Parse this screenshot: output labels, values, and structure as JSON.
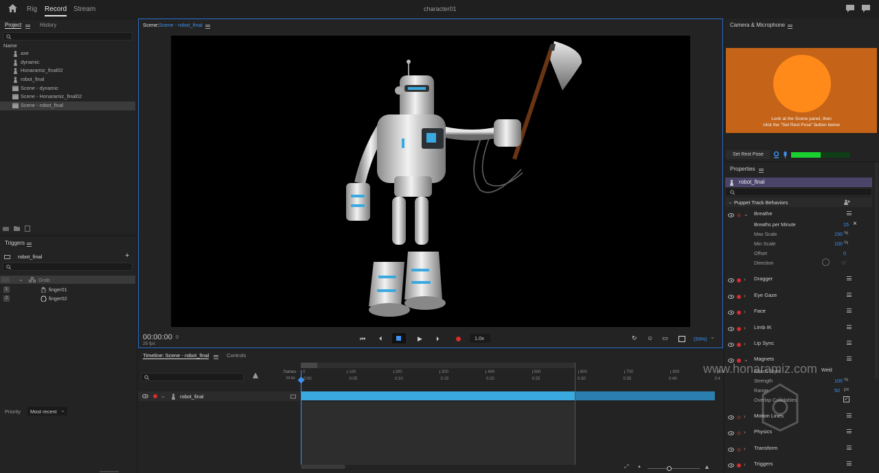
{
  "app": {
    "title": "character01",
    "menus": [
      "Rig",
      "Record",
      "Stream"
    ],
    "active_menu": "Record",
    "accent": "#2d9ae0",
    "record_color": "#d92c2c",
    "icons": [
      "home-icon",
      "chat-icon",
      "help-icon"
    ]
  },
  "project": {
    "tabs": [
      "Project",
      "History"
    ],
    "column": "Name",
    "items": [
      {
        "label": "axe",
        "icon": "puppet-icon"
      },
      {
        "label": "dynamic",
        "icon": "puppet-icon"
      },
      {
        "label": "Honaramiz_final02",
        "icon": "puppet-icon"
      },
      {
        "label": "robot_final",
        "icon": "puppet-icon"
      },
      {
        "label": "Scene - dynamic",
        "icon": "scene-icon"
      },
      {
        "label": "Scene - Honaramiz_final02",
        "icon": "scene-icon"
      },
      {
        "label": "Scene - robot_final",
        "icon": "scene-icon"
      }
    ],
    "selected_index": 6
  },
  "triggers": {
    "title": "Triggers",
    "puppet": "robot_final",
    "group": "Grab",
    "children": [
      {
        "key": "1",
        "label": "finger01"
      },
      {
        "key": "2",
        "label": "finger02"
      }
    ],
    "priority_label": "Priority",
    "priority_value": "Most recent"
  },
  "scene": {
    "prefix": "Scene:",
    "name": "Scene - robot_final",
    "time": "00:00:00",
    "frame": "0",
    "fps": "25 fps",
    "speed": "1.0x",
    "zoom": "(59%)"
  },
  "timeline": {
    "tabs": [
      "Timeline: Scene - robot_final",
      "Controls"
    ],
    "frames_label": "frames",
    "mss_label": "m:ss",
    "frame_ticks": [
      "0",
      "100",
      "200",
      "300",
      "400",
      "500",
      "600",
      "700",
      "800",
      "900",
      "1000"
    ],
    "time_ticks": [
      "0:00",
      "0:05",
      "0:10",
      "0:15",
      "0:20",
      "0:25",
      "0:30",
      "0:35",
      "0:40",
      "0:4"
    ],
    "track": "robot_final"
  },
  "camera": {
    "title": "Camera & Microphone",
    "message_line1": "Look at the Scene panel, then",
    "message_line2": "click the \"Set Rest Pose\" button below",
    "set_rest_pose": "Set Rest Pose",
    "mic_level": 0.5
  },
  "properties": {
    "title": "Properties",
    "puppet": "robot_final",
    "section": "Puppet Track Behaviors",
    "breathe": {
      "label": "Breathe",
      "params": [
        {
          "name": "Breaths per Minute",
          "value": "15",
          "unit": ""
        },
        {
          "name": "Max Scale",
          "value": "150",
          "unit": "%"
        },
        {
          "name": "Min Scale",
          "value": "100",
          "unit": "%"
        },
        {
          "name": "Offset",
          "value": "0",
          "unit": ""
        },
        {
          "name": "Direction",
          "value": "0",
          "unit": "°"
        }
      ]
    },
    "behaviors": [
      "Dragger",
      "Eye Gaze",
      "Face",
      "Limb IK",
      "Lip Sync",
      "Magnets"
    ],
    "magnets_params": [
      {
        "name": "Attach Style",
        "value": "Weld",
        "unit": ""
      },
      {
        "name": "Strength",
        "value": "100",
        "unit": "%"
      },
      {
        "name": "Range",
        "value": "50",
        "unit": "px"
      },
      {
        "name": "Overlap Collidables",
        "value": "",
        "unit": ""
      }
    ],
    "behaviors_after": [
      "Motion Lines",
      "Physics",
      "Transform",
      "Triggers"
    ]
  },
  "watermark": "www.honaramiz.com"
}
